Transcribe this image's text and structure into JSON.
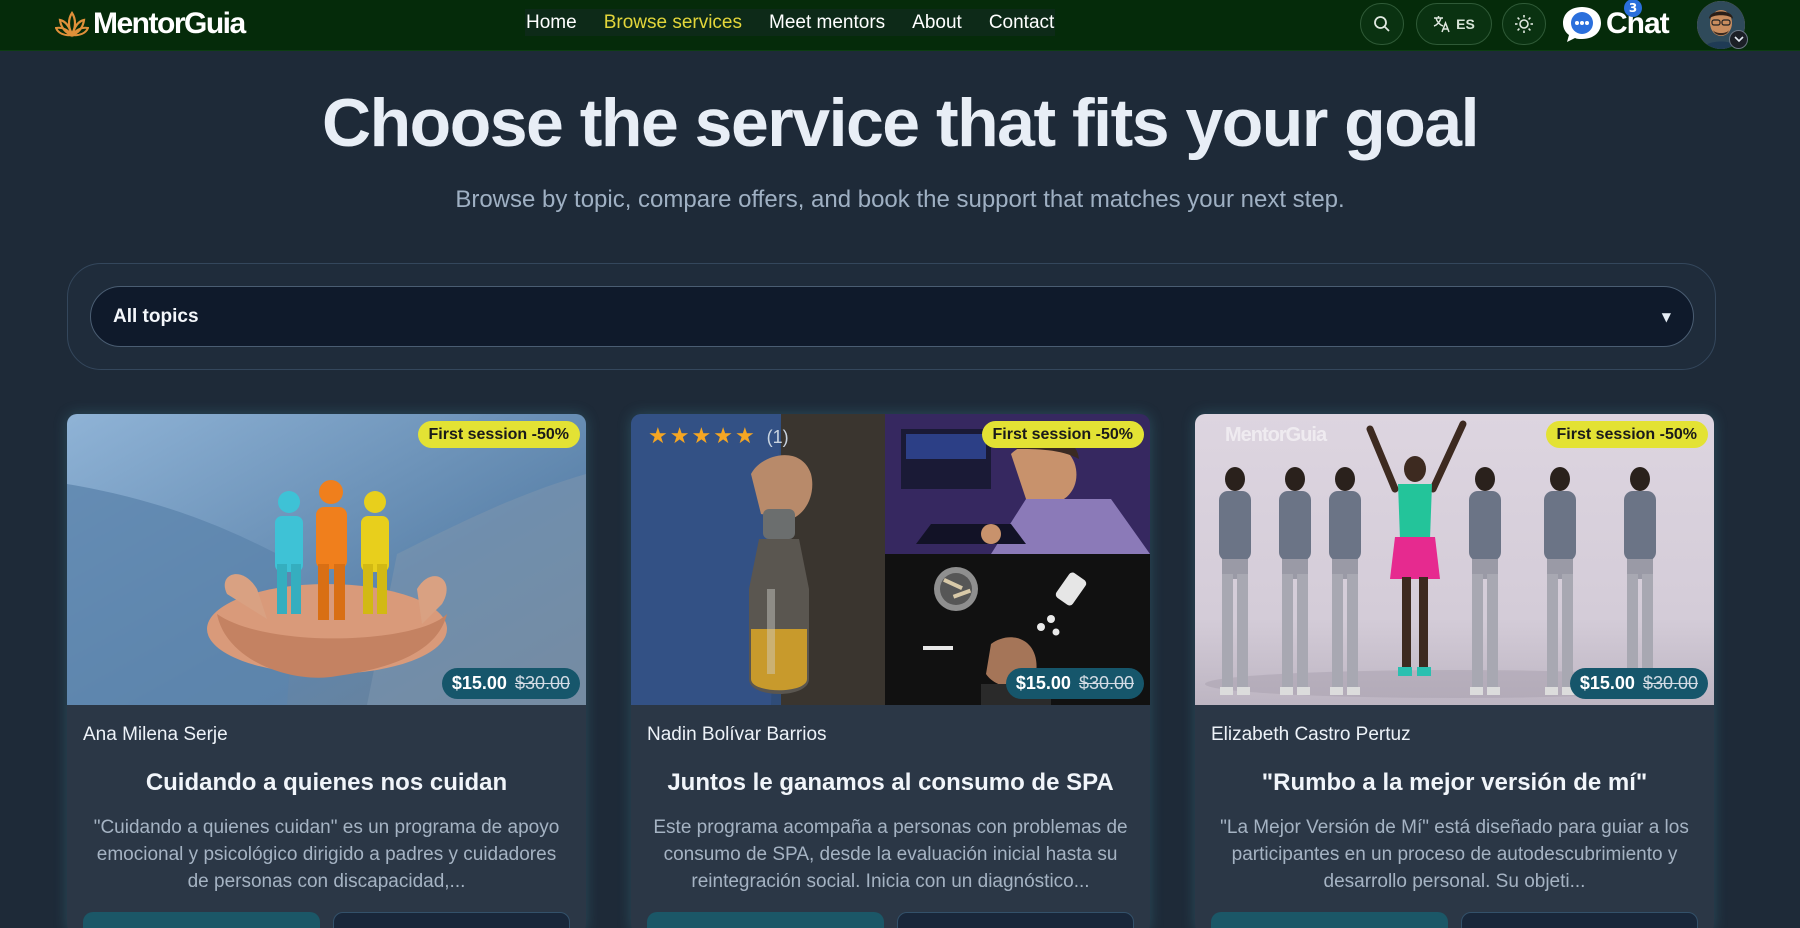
{
  "brand": {
    "name": "MentorGuia"
  },
  "nav": {
    "links": [
      "Home",
      "Browse services",
      "Meet mentors",
      "About",
      "Contact"
    ],
    "active_index": 1,
    "language": "ES",
    "chat_label": "Chat",
    "chat_badge": "3",
    "icons": [
      "search-icon",
      "translate-icon",
      "sun-icon",
      "chat-bubble-icon",
      "avatar",
      "chevron-down-icon"
    ]
  },
  "hero": {
    "title": "Choose the service that fits your goal",
    "subtitle": "Browse by topic, compare offers, and book the support that matches your next step."
  },
  "filter": {
    "selected": "All topics"
  },
  "cards": [
    {
      "promo": "First session -50%",
      "price_now": "$15.00",
      "price_old": "$30.00",
      "author": "Ana Milena Serje",
      "title": "Cuidando a quienes nos cuidan",
      "description": "\"Cuidando a quienes cuidan\" es un programa de apoyo emocional y psicológico dirigido a padres y cuidadores de personas con discapacidad,..."
    },
    {
      "promo": "First session -50%",
      "price_now": "$15.00",
      "price_old": "$30.00",
      "rating_stars": 5,
      "rating_count": "(1)",
      "author": "Nadin Bolívar Barrios",
      "title": "Juntos le ganamos al consumo de SPA",
      "description": "Este programa acompaña a personas con problemas de consumo de SPA, desde la evaluación inicial hasta su reintegración social. Inicia con un diagnóstico..."
    },
    {
      "promo": "First session -50%",
      "price_now": "$15.00",
      "price_old": "$30.00",
      "watermark": "MentorGuia",
      "author": "Elizabeth Castro Pertuz",
      "title": "\"Rumbo a la mejor versión de mí\"",
      "description": "\"La Mejor Versión de Mí\" está diseñado para guiar a los participantes en un proceso de autodescubrimiento y desarrollo personal. Su objeti..."
    }
  ],
  "colors": {
    "navbar": "#052b0a",
    "background": "#1e2a38",
    "active_link": "#e3d63a",
    "promo_badge": "#e3e234",
    "price_badge": "#16566b"
  }
}
